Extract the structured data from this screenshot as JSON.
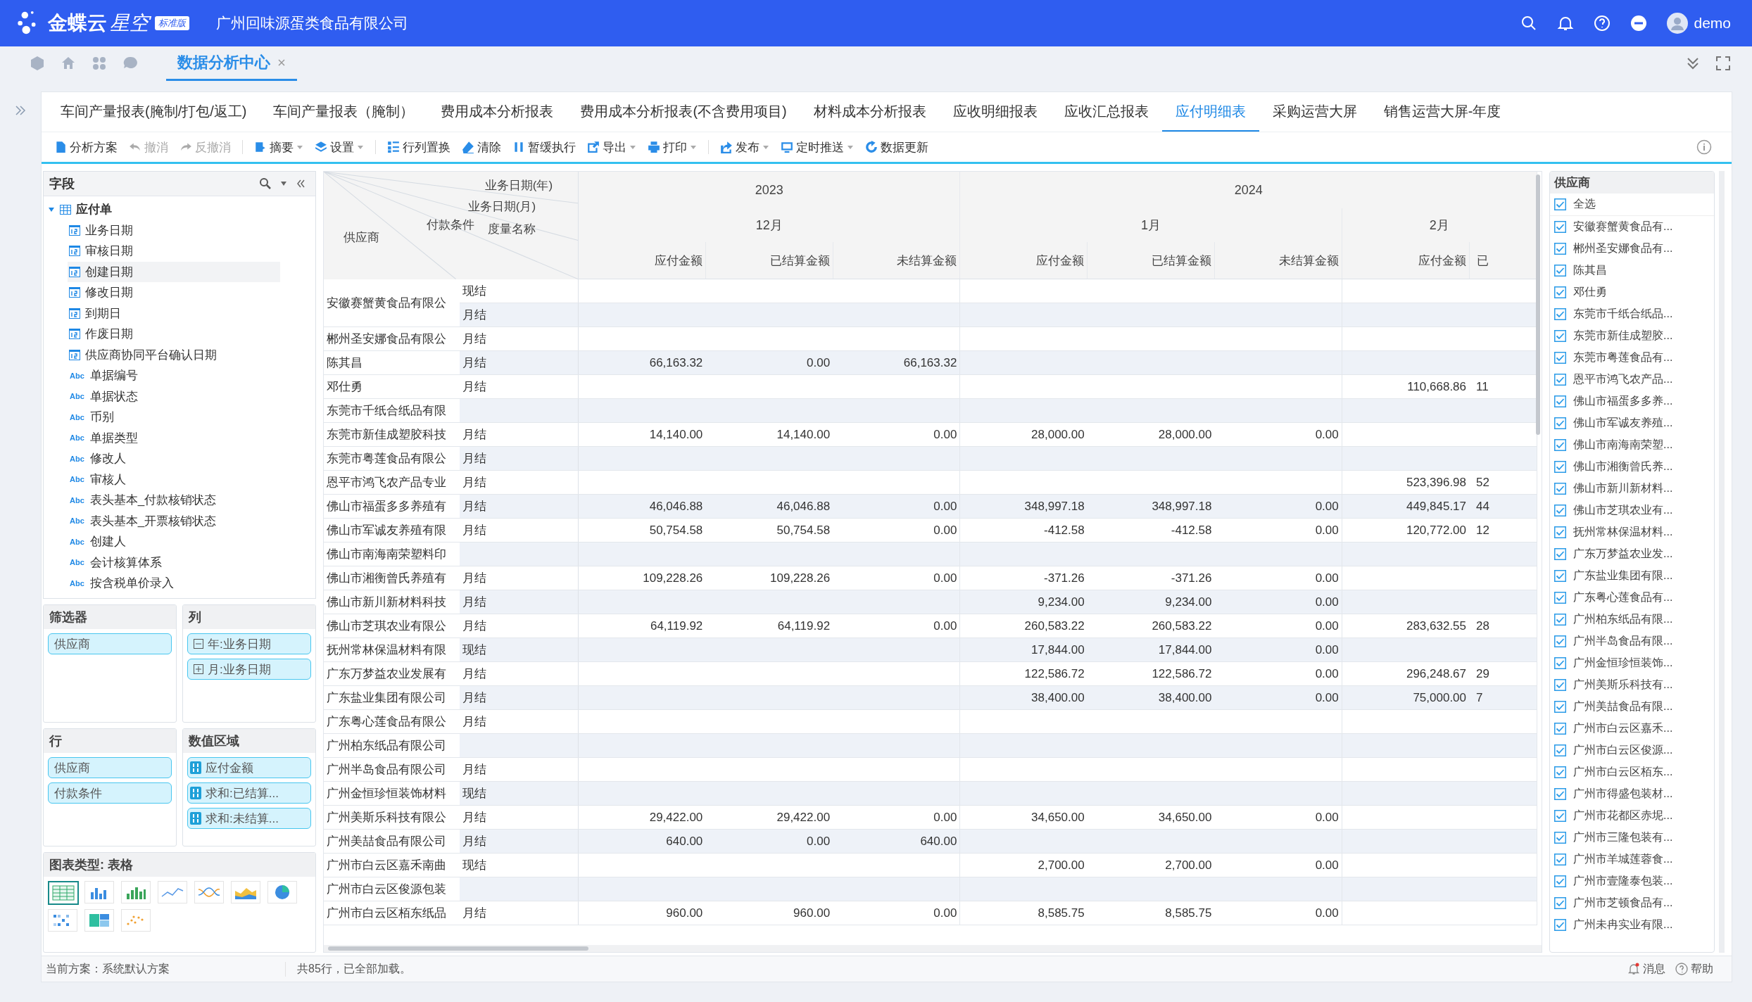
{
  "top_bar": {
    "brand": "金蝶云",
    "product": "星空",
    "edition": "标准版",
    "company": "广州回味源蛋类食品有限公司",
    "user": "demo"
  },
  "nav_tabs": [
    {
      "label": "数据分析中心",
      "selected": true
    }
  ],
  "report_tabs": [
    {
      "label": "车间产量报表(腌制/打包/返工)",
      "selected": false
    },
    {
      "label": "车间产量报表（腌制）",
      "selected": false
    },
    {
      "label": "费用成本分析报表",
      "selected": false
    },
    {
      "label": "费用成本分析报表(不含费用项目)",
      "selected": false
    },
    {
      "label": "材料成本分析报表",
      "selected": false
    },
    {
      "label": "应收明细报表",
      "selected": false
    },
    {
      "label": "应收汇总报表",
      "selected": false
    },
    {
      "label": "应付明细表",
      "selected": true
    },
    {
      "label": "采购运营大屏",
      "selected": false
    },
    {
      "label": "销售运营大屏-年度",
      "selected": false
    }
  ],
  "toolbar": [
    {
      "label": "分析方案",
      "kind": "doc",
      "disabled": false,
      "dropdown": false
    },
    {
      "label": "撤消",
      "kind": "undo",
      "disabled": true,
      "dropdown": false
    },
    {
      "label": "反撤消",
      "kind": "redo",
      "disabled": true,
      "dropdown": false
    },
    {
      "label": "摘要",
      "kind": "summary",
      "disabled": false,
      "dropdown": true
    },
    {
      "label": "设置",
      "kind": "layers",
      "disabled": false,
      "dropdown": true
    },
    {
      "label": "行列置换",
      "kind": "swap",
      "disabled": false,
      "dropdown": false
    },
    {
      "label": "清除",
      "kind": "eraser",
      "disabled": false,
      "dropdown": false
    },
    {
      "label": "暂缓执行",
      "kind": "pause",
      "disabled": false,
      "dropdown": false
    },
    {
      "label": "导出",
      "kind": "export",
      "disabled": false,
      "dropdown": true
    },
    {
      "label": "打印",
      "kind": "print",
      "disabled": false,
      "dropdown": true
    },
    {
      "label": "发布",
      "kind": "publish",
      "disabled": false,
      "dropdown": true
    },
    {
      "label": "定时推送",
      "kind": "schedule",
      "disabled": false,
      "dropdown": true
    },
    {
      "label": "数据更新",
      "kind": "refresh",
      "disabled": false,
      "dropdown": false
    }
  ],
  "fields": {
    "title": "字段",
    "tree": {
      "label": "应付单",
      "expanded": true,
      "children": [
        {
          "label": "业务日期",
          "kind": "date",
          "selected": false
        },
        {
          "label": "审核日期",
          "kind": "date",
          "selected": false
        },
        {
          "label": "创建日期",
          "kind": "date",
          "selected": true
        },
        {
          "label": "修改日期",
          "kind": "date",
          "selected": false
        },
        {
          "label": "到期日",
          "kind": "date",
          "selected": false
        },
        {
          "label": "作废日期",
          "kind": "date",
          "selected": false
        },
        {
          "label": "供应商协同平台确认日期",
          "kind": "date",
          "selected": false
        },
        {
          "label": "单据编号",
          "kind": "text",
          "type_label": "Abc",
          "selected": false
        },
        {
          "label": "单据状态",
          "kind": "text",
          "type_label": "Abc",
          "selected": false
        },
        {
          "label": "币别",
          "kind": "text",
          "type_label": "Abc",
          "selected": false
        },
        {
          "label": "单据类型",
          "kind": "text",
          "type_label": "Abc",
          "selected": false
        },
        {
          "label": "修改人",
          "kind": "text",
          "type_label": "Abc",
          "selected": false
        },
        {
          "label": "审核人",
          "kind": "text",
          "type_label": "Abc",
          "selected": false
        },
        {
          "label": "表头基本_付款核销状态",
          "kind": "text",
          "type_label": "Abc",
          "selected": false
        },
        {
          "label": "表头基本_开票核销状态",
          "kind": "text",
          "type_label": "Abc",
          "selected": false
        },
        {
          "label": "创建人",
          "kind": "text",
          "type_label": "Abc",
          "selected": false
        },
        {
          "label": "会计核算体系",
          "kind": "text",
          "type_label": "Abc",
          "selected": false
        },
        {
          "label": "按含税单价录入",
          "kind": "text",
          "type_label": "Abc",
          "selected": false
        }
      ]
    }
  },
  "pivot": {
    "filters": {
      "title": "筛选器",
      "items": [
        "供应商"
      ]
    },
    "columns": {
      "title": "列",
      "items": [
        {
          "label": "年:业务日期",
          "expanded": true
        },
        {
          "label": "月:业务日期",
          "expanded": false
        }
      ]
    },
    "rows": {
      "title": "行",
      "items": [
        "供应商",
        "付款条件"
      ]
    },
    "values": {
      "title": "数值区域",
      "items": [
        "应付金额",
        "求和:已结算...",
        "求和:未结算..."
      ]
    }
  },
  "chart_types": {
    "title": "图表类型: 表格",
    "items": [
      {
        "kind": "table",
        "selected": true
      },
      {
        "kind": "bar",
        "selected": false
      },
      {
        "kind": "column-green",
        "selected": false
      },
      {
        "kind": "line",
        "selected": false
      },
      {
        "kind": "multiline",
        "selected": false
      },
      {
        "kind": "area",
        "selected": false
      },
      {
        "kind": "pie",
        "selected": false
      },
      {
        "kind": "heatmap",
        "selected": false
      },
      {
        "kind": "treemap",
        "selected": false
      },
      {
        "kind": "scatter",
        "selected": false
      }
    ]
  },
  "table": {
    "corner": {
      "year": "业务日期(年)",
      "month": "业务日期(月)",
      "measure": "度量名称",
      "supplier": "供应商",
      "terms": "付款条件"
    },
    "years": [
      {
        "label": "2023",
        "months": [
          {
            "label": "12月",
            "measures": [
              "应付金额",
              "已结算金额",
              "未结算金额"
            ]
          }
        ]
      },
      {
        "label": "2024",
        "months": [
          {
            "label": "1月",
            "measures": [
              "应付金额",
              "已结算金额",
              "未结算金额"
            ]
          },
          {
            "label": "2月",
            "measures": [
              "应付金额",
              "已"
            ]
          }
        ]
      }
    ],
    "rows": [
      {
        "supplier": "安徽赛蟹黄食品有限公",
        "terms": [
          {
            "term": "现结"
          },
          {
            "term": "月结"
          }
        ]
      },
      {
        "supplier": "郴州圣安娜食品有限公",
        "terms": [
          {
            "term": "月结"
          }
        ]
      },
      {
        "supplier": "陈其昌",
        "terms": [
          {
            "term": "月结",
            "dec_2023": {
              "payable": "66,163.32",
              "settled": "0.00",
              "unsettled": "66,163.32"
            }
          }
        ]
      },
      {
        "supplier": "邓仕勇",
        "terms": [
          {
            "term": "月结",
            "feb_2024": {
              "payable": "110,668.86",
              "settled": "11"
            }
          }
        ]
      },
      {
        "supplier": "东莞市千纸合纸品有限"
      },
      {
        "supplier": "东莞市新佳成塑胶科技",
        "terms": [
          {
            "term": "月结",
            "dec_2023": {
              "payable": "14,140.00",
              "settled": "14,140.00",
              "unsettled": "0.00"
            },
            "jan_2024": {
              "payable": "28,000.00",
              "settled": "28,000.00",
              "unsettled": "0.00"
            }
          }
        ]
      },
      {
        "supplier": "东莞市粤莲食品有限公",
        "terms": [
          {
            "term": "月结"
          }
        ]
      },
      {
        "supplier": "恩平市鸿飞农产品专业",
        "terms": [
          {
            "term": "月结",
            "feb_2024": {
              "payable": "523,396.98",
              "settled": "52"
            }
          }
        ]
      },
      {
        "supplier": "佛山市福蛋多多养殖有",
        "terms": [
          {
            "term": "月结",
            "dec_2023": {
              "payable": "46,046.88",
              "settled": "46,046.88",
              "unsettled": "0.00"
            },
            "jan_2024": {
              "payable": "348,997.18",
              "settled": "348,997.18",
              "unsettled": "0.00"
            },
            "feb_2024": {
              "payable": "449,845.17",
              "settled": "44"
            }
          }
        ]
      },
      {
        "supplier": "佛山市军诚友养殖有限",
        "terms": [
          {
            "term": "月结",
            "dec_2023": {
              "payable": "50,754.58",
              "settled": "50,754.58",
              "unsettled": "0.00"
            },
            "jan_2024": {
              "payable": "-412.58",
              "settled": "-412.58",
              "unsettled": "0.00"
            },
            "feb_2024": {
              "payable": "120,772.00",
              "settled": "12"
            }
          }
        ]
      },
      {
        "supplier": "佛山市南海南荣塑料印"
      },
      {
        "supplier": "佛山市湘衡曾氏养殖有",
        "terms": [
          {
            "term": "月结",
            "dec_2023": {
              "payable": "109,228.26",
              "settled": "109,228.26",
              "unsettled": "0.00"
            },
            "jan_2024": {
              "payable": "-371.26",
              "settled": "-371.26",
              "unsettled": "0.00"
            }
          }
        ]
      },
      {
        "supplier": "佛山市新川新材料科技",
        "terms": [
          {
            "term": "月结",
            "jan_2024": {
              "payable": "9,234.00",
              "settled": "9,234.00",
              "unsettled": "0.00"
            }
          }
        ]
      },
      {
        "supplier": "佛山市芝琪农业有限公",
        "terms": [
          {
            "term": "月结",
            "dec_2023": {
              "payable": "64,119.92",
              "settled": "64,119.92",
              "unsettled": "0.00"
            },
            "jan_2024": {
              "payable": "260,583.22",
              "settled": "260,583.22",
              "unsettled": "0.00"
            },
            "feb_2024": {
              "payable": "283,632.55",
              "settled": "28"
            }
          }
        ]
      },
      {
        "supplier": "抚州常林保温材料有限",
        "terms": [
          {
            "term": "现结",
            "jan_2024": {
              "payable": "17,844.00",
              "settled": "17,844.00",
              "unsettled": "0.00"
            }
          }
        ]
      },
      {
        "supplier": "广东万梦益农业发展有",
        "terms": [
          {
            "term": "月结",
            "jan_2024": {
              "payable": "122,586.72",
              "settled": "122,586.72",
              "unsettled": "0.00"
            },
            "feb_2024": {
              "payable": "296,248.67",
              "settled": "29"
            }
          }
        ]
      },
      {
        "supplier": "广东盐业集团有限公司",
        "terms": [
          {
            "term": "月结",
            "jan_2024": {
              "payable": "38,400.00",
              "settled": "38,400.00",
              "unsettled": "0.00"
            },
            "feb_2024": {
              "payable": "75,000.00",
              "settled": "7"
            }
          }
        ]
      },
      {
        "supplier": "广东粤心莲食品有限公",
        "terms": [
          {
            "term": "月结"
          }
        ]
      },
      {
        "supplier": "广州柏东纸品有限公司"
      },
      {
        "supplier": "广州半岛食品有限公司",
        "terms": [
          {
            "term": "月结"
          }
        ]
      },
      {
        "supplier": "广州金恒珍恒装饰材料",
        "terms": [
          {
            "term": "现结"
          }
        ]
      },
      {
        "supplier": "广州美斯乐科技有限公",
        "terms": [
          {
            "term": "月结",
            "dec_2023": {
              "payable": "29,422.00",
              "settled": "29,422.00",
              "unsettled": "0.00"
            },
            "jan_2024": {
              "payable": "34,650.00",
              "settled": "34,650.00",
              "unsettled": "0.00"
            }
          }
        ]
      },
      {
        "supplier": "广州美喆食品有限公司",
        "terms": [
          {
            "term": "月结",
            "dec_2023": {
              "payable": "640.00",
              "settled": "0.00",
              "unsettled": "640.00"
            }
          }
        ]
      },
      {
        "supplier": "广州市白云区嘉禾南曲",
        "terms": [
          {
            "term": "现结",
            "jan_2024": {
              "payable": "2,700.00",
              "settled": "2,700.00",
              "unsettled": "0.00"
            }
          }
        ]
      },
      {
        "supplier": "广州市白云区俊源包装"
      },
      {
        "supplier": "广州市白云区栢东纸品",
        "terms": [
          {
            "term": "月结",
            "dec_2023": {
              "payable": "960.00",
              "settled": "960.00",
              "unsettled": "0.00"
            },
            "jan_2024": {
              "payable": "8,585.75",
              "settled": "8,585.75",
              "unsettled": "0.00"
            }
          }
        ]
      }
    ]
  },
  "filter_panel": {
    "title": "供应商",
    "items": [
      {
        "label": "全选",
        "checked": true
      },
      {
        "label": "安徽赛蟹黄食品有...",
        "checked": true
      },
      {
        "label": "郴州圣安娜食品有...",
        "checked": true
      },
      {
        "label": "陈其昌",
        "checked": true
      },
      {
        "label": "邓仕勇",
        "checked": true
      },
      {
        "label": "东莞市千纸合纸品...",
        "checked": true
      },
      {
        "label": "东莞市新佳成塑胶...",
        "checked": true
      },
      {
        "label": "东莞市粤莲食品有...",
        "checked": true
      },
      {
        "label": "恩平市鸿飞农产品...",
        "checked": true
      },
      {
        "label": "佛山市福蛋多多养...",
        "checked": true
      },
      {
        "label": "佛山市军诚友养殖...",
        "checked": true
      },
      {
        "label": "佛山市南海南荣塑...",
        "checked": true
      },
      {
        "label": "佛山市湘衡曾氏养...",
        "checked": true
      },
      {
        "label": "佛山市新川新材料...",
        "checked": true
      },
      {
        "label": "佛山市芝琪农业有...",
        "checked": true
      },
      {
        "label": "抚州常林保温材料...",
        "checked": true
      },
      {
        "label": "广东万梦益农业发...",
        "checked": true
      },
      {
        "label": "广东盐业集团有限...",
        "checked": true
      },
      {
        "label": "广东粤心莲食品有...",
        "checked": true
      },
      {
        "label": "广州柏东纸品有限...",
        "checked": true
      },
      {
        "label": "广州半岛食品有限...",
        "checked": true
      },
      {
        "label": "广州金恒珍恒装饰...",
        "checked": true
      },
      {
        "label": "广州美斯乐科技有...",
        "checked": true
      },
      {
        "label": "广州美喆食品有限...",
        "checked": true
      },
      {
        "label": "广州市白云区嘉禾...",
        "checked": true
      },
      {
        "label": "广州市白云区俊源...",
        "checked": true
      },
      {
        "label": "广州市白云区栢东...",
        "checked": true
      },
      {
        "label": "广州市得盛包装材...",
        "checked": true
      },
      {
        "label": "广州市花都区赤坭...",
        "checked": true
      },
      {
        "label": "广州市三隆包装有...",
        "checked": true
      },
      {
        "label": "广州市羊城莲蓉食...",
        "checked": true
      },
      {
        "label": "广州市壹隆泰包装...",
        "checked": true
      },
      {
        "label": "广州市芝顿食品有...",
        "checked": true
      },
      {
        "label": "广州未冉实业有限...",
        "checked": true
      }
    ]
  },
  "status_bar": {
    "scheme": "当前方案：系统默认方案",
    "count": "共85行，已全部加载。",
    "messages": "消息",
    "has_unread": true,
    "help": "帮助"
  }
}
